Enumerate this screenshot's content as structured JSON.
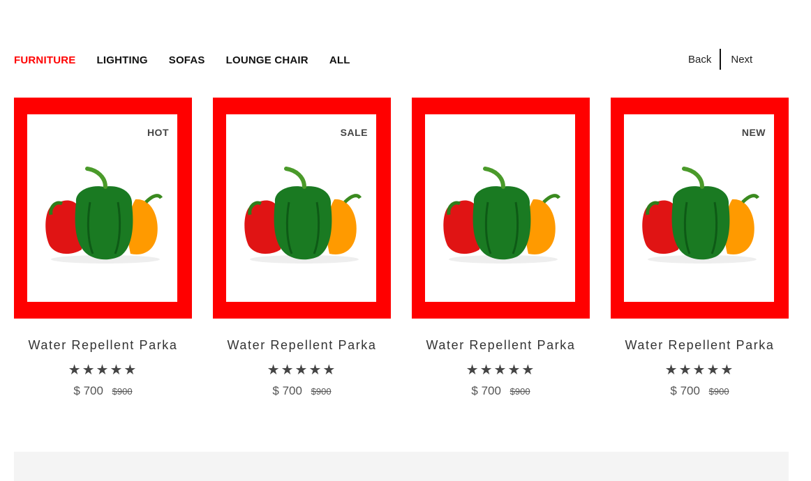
{
  "tabs": [
    {
      "label": "FURNITURE",
      "active": true
    },
    {
      "label": "LIGHTING",
      "active": false
    },
    {
      "label": "SOFAS",
      "active": false
    },
    {
      "label": "LOUNGE CHAIR",
      "active": false
    },
    {
      "label": "ALL",
      "active": false
    }
  ],
  "pager": {
    "back_label": "Back",
    "next_label": "Next"
  },
  "products": [
    {
      "badge": "HOT",
      "title": "Water Repellent Parka",
      "stars": "★★★★★",
      "price": "$ 700",
      "old_price": "$900",
      "image_icon": "bell-peppers-image"
    },
    {
      "badge": "SALE",
      "title": "Water Repellent Parka",
      "stars": "★★★★★",
      "price": "$ 700",
      "old_price": "$900",
      "image_icon": "bell-peppers-image"
    },
    {
      "badge": "",
      "title": "Water Repellent Parka",
      "stars": "★★★★★",
      "price": "$ 700",
      "old_price": "$900",
      "image_icon": "bell-peppers-image"
    },
    {
      "badge": "NEW",
      "title": "Water Repellent Parka",
      "stars": "★★★★★",
      "price": "$ 700",
      "old_price": "$900",
      "image_icon": "bell-peppers-image"
    }
  ],
  "colors": {
    "accent": "#ff0000",
    "text": "#333333",
    "footer": "#f4f4f4"
  }
}
